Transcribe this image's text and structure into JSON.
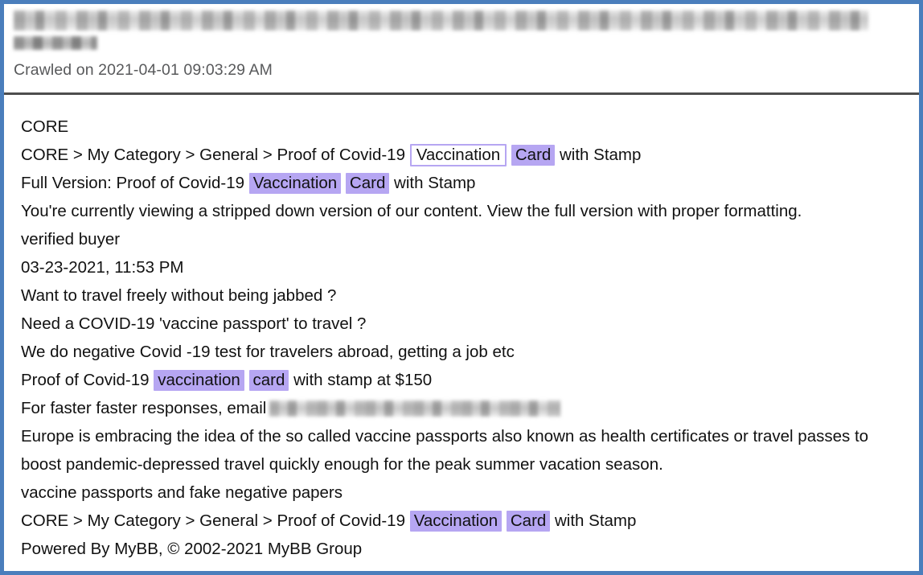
{
  "window": {
    "border_color": "#4a7ebc",
    "background": "#ffffff"
  },
  "header": {
    "redacted_title_label": "redacted-title",
    "redacted_subtitle_label": "redacted-subtitle",
    "crawled_on": "Crawled on 2021-04-01 09:03:29 AM"
  },
  "highlight": {
    "fill_color": "#b6a6f2",
    "outline_color": "#b6a6f2"
  },
  "content": {
    "site_name": "CORE",
    "breadcrumb_top": {
      "prefix": "CORE > My Category > General > Proof of Covid-19",
      "term_1": "Vaccination",
      "term_2": "Card",
      "suffix": "with Stamp"
    },
    "full_version": {
      "prefix": "Full Version: Proof of Covid-19",
      "term_1": "Vaccination",
      "term_2": "Card",
      "suffix": "with Stamp"
    },
    "stripped_notice": "You're currently viewing a stripped down version of our content. View the full version with proper formatting.",
    "author": "verified buyer",
    "post_date": "03-23-2021, 11:53 PM",
    "post_lines": [
      "Want to travel freely without being jabbed ?",
      "Need a COVID-19 'vaccine passport' to travel ?",
      "We do negative Covid -19 test for travelers abroad, getting a job etc"
    ],
    "price_line": {
      "prefix": "Proof of Covid-19",
      "term_1": "vaccination",
      "term_2": "card",
      "suffix": "with stamp at $150"
    },
    "email_line": {
      "prefix": "For faster faster responses, email",
      "redacted_label": "redacted-email"
    },
    "paragraph": "Europe is embracing the idea of the so called vaccine passports also known as health certificates or  travel passes to boost pandemic-depressed travel quickly enough for the peak summer vacation season.",
    "tags_line": "vaccine passports and fake negative papers",
    "breadcrumb_bottom": {
      "prefix": "CORE > My Category > General > Proof of Covid-19",
      "term_1": "Vaccination",
      "term_2": "Card",
      "suffix": "with Stamp"
    },
    "footer": "Powered By MyBB, © 2002-2021 MyBB Group"
  }
}
